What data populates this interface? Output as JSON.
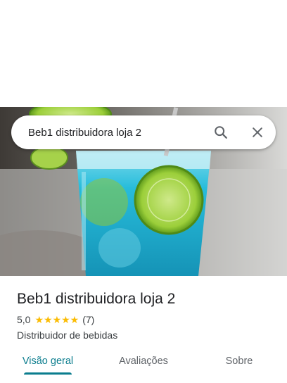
{
  "search": {
    "query": "Beb1 distribuidora loja 2"
  },
  "place": {
    "name": "Beb1 distribuidora loja 2",
    "rating": "5,0",
    "stars": "★★★★★",
    "review_count": "(7)",
    "category": "Distribuidor de bebidas"
  },
  "tabs": [
    {
      "label": "Visão geral",
      "active": true
    },
    {
      "label": "Avaliações",
      "active": false
    },
    {
      "label": "Sobre",
      "active": false
    }
  ],
  "colors": {
    "accent": "#0b7d8e",
    "star": "#fbbc04",
    "drink": "#22b8d6",
    "lime": "#9ccf3a"
  },
  "icons": {
    "search": "search-icon",
    "close": "close-icon"
  }
}
